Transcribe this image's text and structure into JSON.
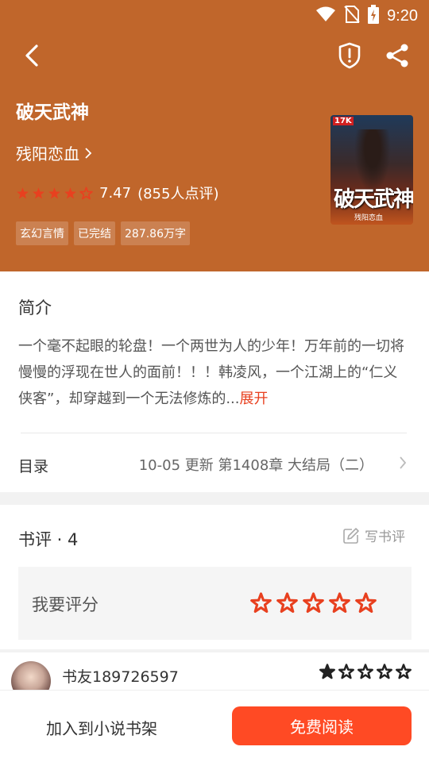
{
  "status": {
    "time": "9:20"
  },
  "book": {
    "title": "破天武神",
    "author": "残阳恋血",
    "rating": "7.47",
    "rating_count": "(855人点评)",
    "stars": 5,
    "tags": [
      "玄幻言情",
      "已完结",
      "287.86万字"
    ],
    "cover": {
      "badge": "17K",
      "title": "破天武神",
      "author": "残阳恋血"
    }
  },
  "intro": {
    "heading": "简介",
    "text": "一个毫不起眼的轮盘！一个两世为人的少年！万年前的一切将慢慢的浮现在世人的面前！！！韩凌风，一个江湖上的“仁义侠客”，却穿越到一个无法修炼的...",
    "expand_label": "展开"
  },
  "toc": {
    "label": "目录",
    "latest": "10-05  更新  第1408章 大结局（二）"
  },
  "reviews": {
    "heading": "书评 · 4",
    "write_label": "写书评",
    "rate_label": "我要评分",
    "rate_stars": 5,
    "items": [
      {
        "name": "书友189726597",
        "stars": 5
      }
    ]
  },
  "bottom": {
    "add_shelf": "加入到小说书架",
    "read_free": "免费阅读"
  },
  "colors": {
    "header": "#c0662b",
    "accent": "#ff4a24",
    "star": "#e8401f"
  }
}
